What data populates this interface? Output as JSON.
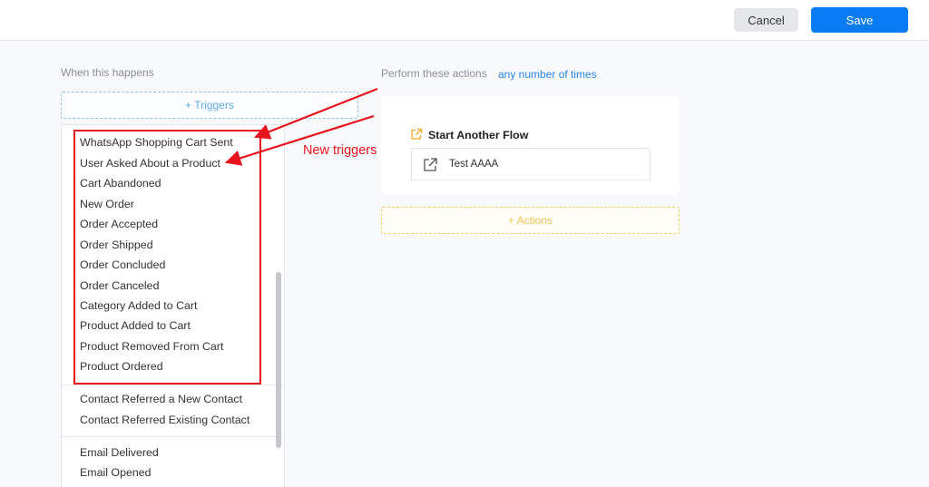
{
  "header": {
    "cancel_label": "Cancel",
    "save_label": "Save"
  },
  "left": {
    "section_label": "When this happens",
    "add_triggers_label": "+ Triggers",
    "triggers": [
      "WhatsApp Shopping Cart Sent",
      "User Asked About a Product",
      "Cart Abandoned",
      "New Order",
      "Order Accepted",
      "Order Shipped",
      "Order Concluded",
      "Order Canceled",
      "Category Added to Cart",
      "Product Added to Cart",
      "Product Removed From Cart",
      "Product Ordered",
      "Contact Referred a New Contact",
      "Contact Referred Existing Contact",
      "Email Delivered",
      "Email Opened"
    ]
  },
  "right": {
    "section_label": "Perform these actions",
    "repeat_link": "any number of times",
    "action_title": "Start Another Flow",
    "flow_name": "Test AAAA",
    "add_actions_label": "+ Actions"
  },
  "annotation": {
    "text": "New triggers",
    "color": "#e8141d"
  },
  "colors": {
    "primary": "#0a7cf3",
    "link": "#2a83e8",
    "triggers_dashed": "#8cc3f2",
    "actions_dashed": "#f3cd6e",
    "action_icon": "#f5a623"
  }
}
